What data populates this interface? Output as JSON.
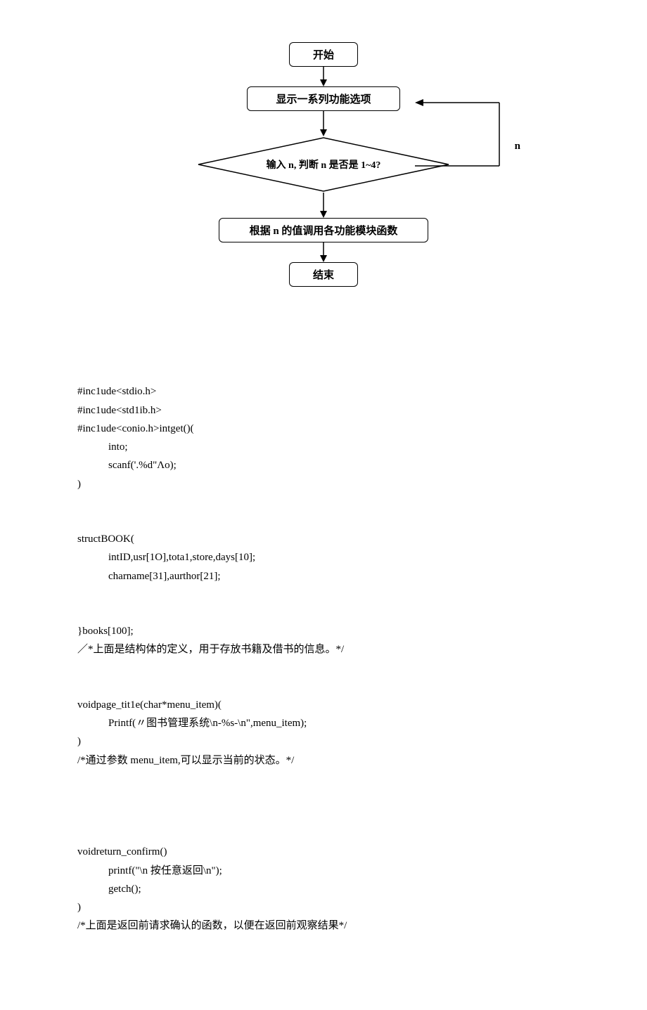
{
  "flow": {
    "start": "开始",
    "show_options": "显示一系列功能选项",
    "decision": "输入 n, 判断 n 是否是 1~4?",
    "call_module": "根据 n 的值调用各功能模块函数",
    "end": "结束",
    "loop_label": "n"
  },
  "code": {
    "l01": "#inc1ude<stdio.h>",
    "l02": "#inc1ude<std1ib.h>",
    "l03": "#inc1ude<conio.h>intget()(",
    "l04": "into;",
    "l05": "scanf('.%d\"Λo);",
    "l06": ")",
    "l07": "structBOOK(",
    "l08": "intID,usr[1O],tota1,store,days[10];",
    "l09": "charname[31],aurthor[21];",
    "l10": "}books[100];",
    "l11": "／*上面是结构体的定义，用于存放书籍及借书的信息。*/",
    "l12": "voidpage_tit1e(char*menu_item)(",
    "l13": "Printf(〃图书管理系统\\n-%s-\\n\",menu_item);",
    "l14": ")",
    "l15": "/*通过参数 menu_item,可以显示当前的状态。*/",
    "l16": "voidreturn_confirm()",
    "l17": "printf(\"\\n 按任意返回\\n\");",
    "l18": "getch();",
    "l19": ")",
    "l20": "/*上面是返回前请求确认的函数，以便在返回前观察结果*/"
  }
}
